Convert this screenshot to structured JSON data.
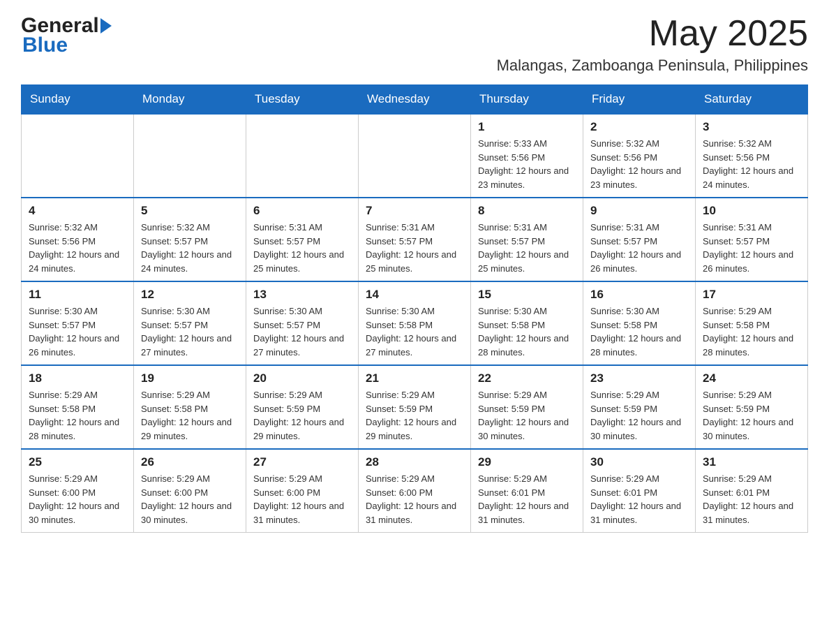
{
  "logo": {
    "general": "General",
    "blue": "Blue"
  },
  "header": {
    "month": "May 2025",
    "location": "Malangas, Zamboanga Peninsula, Philippines"
  },
  "days_of_week": [
    "Sunday",
    "Monday",
    "Tuesday",
    "Wednesday",
    "Thursday",
    "Friday",
    "Saturday"
  ],
  "weeks": [
    [
      {
        "day": "",
        "info": ""
      },
      {
        "day": "",
        "info": ""
      },
      {
        "day": "",
        "info": ""
      },
      {
        "day": "",
        "info": ""
      },
      {
        "day": "1",
        "info": "Sunrise: 5:33 AM\nSunset: 5:56 PM\nDaylight: 12 hours and 23 minutes."
      },
      {
        "day": "2",
        "info": "Sunrise: 5:32 AM\nSunset: 5:56 PM\nDaylight: 12 hours and 23 minutes."
      },
      {
        "day": "3",
        "info": "Sunrise: 5:32 AM\nSunset: 5:56 PM\nDaylight: 12 hours and 24 minutes."
      }
    ],
    [
      {
        "day": "4",
        "info": "Sunrise: 5:32 AM\nSunset: 5:56 PM\nDaylight: 12 hours and 24 minutes."
      },
      {
        "day": "5",
        "info": "Sunrise: 5:32 AM\nSunset: 5:57 PM\nDaylight: 12 hours and 24 minutes."
      },
      {
        "day": "6",
        "info": "Sunrise: 5:31 AM\nSunset: 5:57 PM\nDaylight: 12 hours and 25 minutes."
      },
      {
        "day": "7",
        "info": "Sunrise: 5:31 AM\nSunset: 5:57 PM\nDaylight: 12 hours and 25 minutes."
      },
      {
        "day": "8",
        "info": "Sunrise: 5:31 AM\nSunset: 5:57 PM\nDaylight: 12 hours and 25 minutes."
      },
      {
        "day": "9",
        "info": "Sunrise: 5:31 AM\nSunset: 5:57 PM\nDaylight: 12 hours and 26 minutes."
      },
      {
        "day": "10",
        "info": "Sunrise: 5:31 AM\nSunset: 5:57 PM\nDaylight: 12 hours and 26 minutes."
      }
    ],
    [
      {
        "day": "11",
        "info": "Sunrise: 5:30 AM\nSunset: 5:57 PM\nDaylight: 12 hours and 26 minutes."
      },
      {
        "day": "12",
        "info": "Sunrise: 5:30 AM\nSunset: 5:57 PM\nDaylight: 12 hours and 27 minutes."
      },
      {
        "day": "13",
        "info": "Sunrise: 5:30 AM\nSunset: 5:57 PM\nDaylight: 12 hours and 27 minutes."
      },
      {
        "day": "14",
        "info": "Sunrise: 5:30 AM\nSunset: 5:58 PM\nDaylight: 12 hours and 27 minutes."
      },
      {
        "day": "15",
        "info": "Sunrise: 5:30 AM\nSunset: 5:58 PM\nDaylight: 12 hours and 28 minutes."
      },
      {
        "day": "16",
        "info": "Sunrise: 5:30 AM\nSunset: 5:58 PM\nDaylight: 12 hours and 28 minutes."
      },
      {
        "day": "17",
        "info": "Sunrise: 5:29 AM\nSunset: 5:58 PM\nDaylight: 12 hours and 28 minutes."
      }
    ],
    [
      {
        "day": "18",
        "info": "Sunrise: 5:29 AM\nSunset: 5:58 PM\nDaylight: 12 hours and 28 minutes."
      },
      {
        "day": "19",
        "info": "Sunrise: 5:29 AM\nSunset: 5:58 PM\nDaylight: 12 hours and 29 minutes."
      },
      {
        "day": "20",
        "info": "Sunrise: 5:29 AM\nSunset: 5:59 PM\nDaylight: 12 hours and 29 minutes."
      },
      {
        "day": "21",
        "info": "Sunrise: 5:29 AM\nSunset: 5:59 PM\nDaylight: 12 hours and 29 minutes."
      },
      {
        "day": "22",
        "info": "Sunrise: 5:29 AM\nSunset: 5:59 PM\nDaylight: 12 hours and 30 minutes."
      },
      {
        "day": "23",
        "info": "Sunrise: 5:29 AM\nSunset: 5:59 PM\nDaylight: 12 hours and 30 minutes."
      },
      {
        "day": "24",
        "info": "Sunrise: 5:29 AM\nSunset: 5:59 PM\nDaylight: 12 hours and 30 minutes."
      }
    ],
    [
      {
        "day": "25",
        "info": "Sunrise: 5:29 AM\nSunset: 6:00 PM\nDaylight: 12 hours and 30 minutes."
      },
      {
        "day": "26",
        "info": "Sunrise: 5:29 AM\nSunset: 6:00 PM\nDaylight: 12 hours and 30 minutes."
      },
      {
        "day": "27",
        "info": "Sunrise: 5:29 AM\nSunset: 6:00 PM\nDaylight: 12 hours and 31 minutes."
      },
      {
        "day": "28",
        "info": "Sunrise: 5:29 AM\nSunset: 6:00 PM\nDaylight: 12 hours and 31 minutes."
      },
      {
        "day": "29",
        "info": "Sunrise: 5:29 AM\nSunset: 6:01 PM\nDaylight: 12 hours and 31 minutes."
      },
      {
        "day": "30",
        "info": "Sunrise: 5:29 AM\nSunset: 6:01 PM\nDaylight: 12 hours and 31 minutes."
      },
      {
        "day": "31",
        "info": "Sunrise: 5:29 AM\nSunset: 6:01 PM\nDaylight: 12 hours and 31 minutes."
      }
    ]
  ]
}
